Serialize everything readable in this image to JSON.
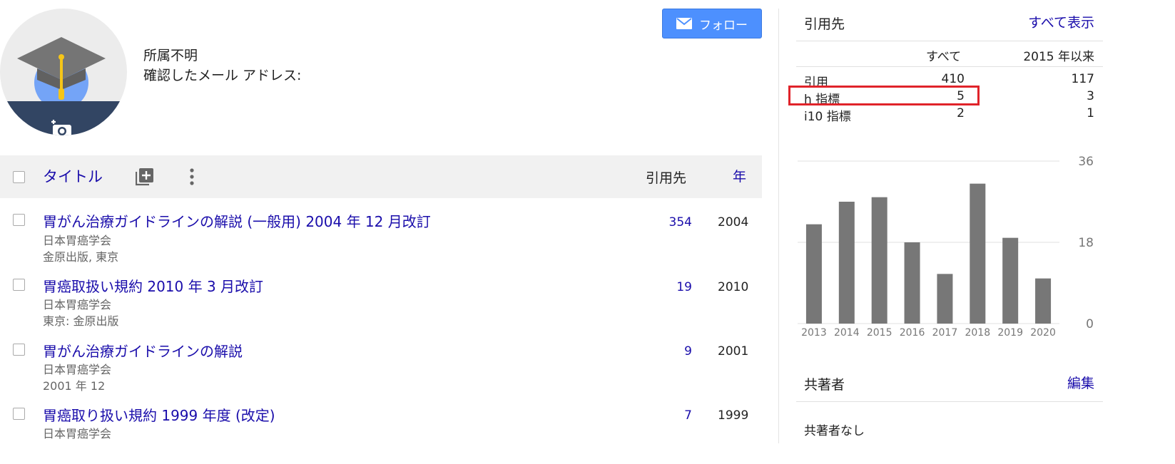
{
  "profile": {
    "affiliation": "所属不明",
    "email_label": "確認したメール アドレス:",
    "follow_label": "フォロー"
  },
  "table": {
    "header": {
      "title": "タイトル",
      "cited_by": "引用先",
      "year": "年"
    },
    "rows": [
      {
        "title": "胃がん治療ガイドラインの解説 (一般用) 2004 年 12 月改訂",
        "authors": "日本胃癌学会",
        "source": "金原出版, 東京",
        "cited": "354",
        "year": "2004"
      },
      {
        "title": "胃癌取扱い規約 2010 年 3 月改訂",
        "authors": "日本胃癌学会",
        "source": "東京: 金原出版",
        "cited": "19",
        "year": "2010"
      },
      {
        "title": "胃がん治療ガイドラインの解説",
        "authors": "日本胃癌学会",
        "source": "2001 年 12",
        "cited": "9",
        "year": "2001"
      },
      {
        "title": "胃癌取り扱い規約 1999 年度 (改定)",
        "authors": "日本胃癌学会",
        "source": "",
        "cited": "7",
        "year": "1999"
      }
    ]
  },
  "citations": {
    "title": "引用先",
    "show_all": "すべて表示",
    "col_all": "すべて",
    "col_since": "2015 年以来",
    "rows": [
      {
        "label": "引用",
        "all": "410",
        "since": "117"
      },
      {
        "label": "h 指標",
        "all": "5",
        "since": "3"
      },
      {
        "label": "i10 指標",
        "all": "2",
        "since": "1"
      }
    ]
  },
  "chart_data": {
    "type": "bar",
    "categories": [
      "2013",
      "2014",
      "2015",
      "2016",
      "2017",
      "2018",
      "2019",
      "2020"
    ],
    "values": [
      22,
      27,
      28,
      18,
      11,
      31,
      19,
      10
    ],
    "ylim": [
      0,
      36
    ],
    "yticks": [
      "0",
      "18",
      "36"
    ],
    "bar_color": "#777777"
  },
  "coauthors": {
    "title": "共著者",
    "edit": "編集",
    "none": "共著者なし"
  },
  "colors": {
    "link": "#1a0dab",
    "button": "#4d90fe",
    "highlight": "#e0232a"
  }
}
